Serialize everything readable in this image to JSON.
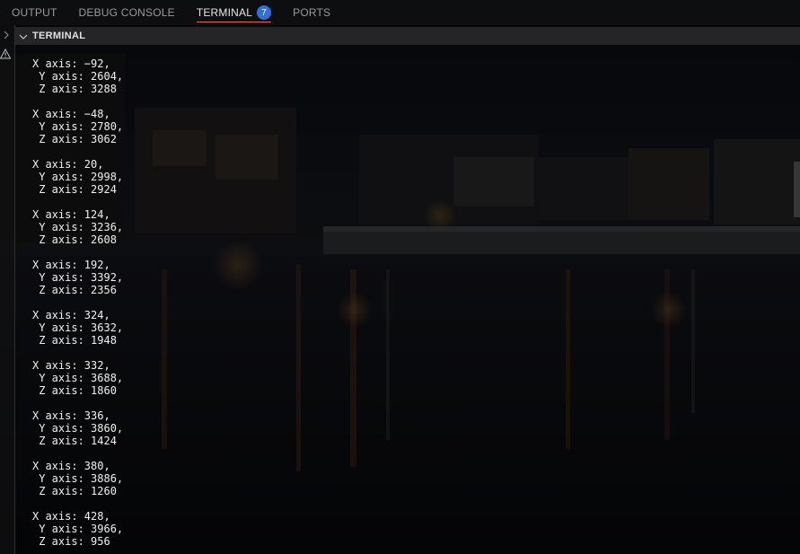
{
  "panel": {
    "tabs": [
      {
        "label": "OUTPUT"
      },
      {
        "label": "DEBUG CONSOLE"
      },
      {
        "label": "TERMINAL",
        "badge": "7"
      },
      {
        "label": "PORTS"
      }
    ],
    "active_tab": "TERMINAL"
  },
  "section": {
    "title": "TERMINAL"
  },
  "terminal": {
    "entries": [
      {
        "x": "X axis: −92,",
        "y": " Y axis: 2604,",
        "z": " Z axis: 3288"
      },
      {
        "x": "X axis: −48,",
        "y": " Y axis: 2780,",
        "z": " Z axis: 3062"
      },
      {
        "x": "X axis: 20,",
        "y": " Y axis: 2998,",
        "z": " Z axis: 2924"
      },
      {
        "x": "X axis: 124,",
        "y": " Y axis: 3236,",
        "z": " Z axis: 2608"
      },
      {
        "x": "X axis: 192,",
        "y": " Y axis: 3392,",
        "z": " Z axis: 2356"
      },
      {
        "x": "X axis: 324,",
        "y": " Y axis: 3632,",
        "z": " Z axis: 1948"
      },
      {
        "x": "X axis: 332,",
        "y": " Y axis: 3688,",
        "z": " Z axis: 1860"
      },
      {
        "x": "X axis: 336,",
        "y": " Y axis: 3860,",
        "z": " Z axis: 1424"
      },
      {
        "x": "X axis: 380,",
        "y": " Y axis: 3886,",
        "z": " Z axis: 1260"
      },
      {
        "x": "X axis: 428,",
        "y": " Y axis: 3966,",
        "z": " Z axis: 956"
      }
    ]
  },
  "icons": {
    "gutter_top": "chevron-right-icon",
    "gutter_warning": "warning-icon",
    "section_toggle": "chevron-down-icon"
  },
  "colors": {
    "active_tab_underline": "#e06a55",
    "badge_background": "#2f6fd8",
    "terminal_text": "#f0f0f0"
  }
}
